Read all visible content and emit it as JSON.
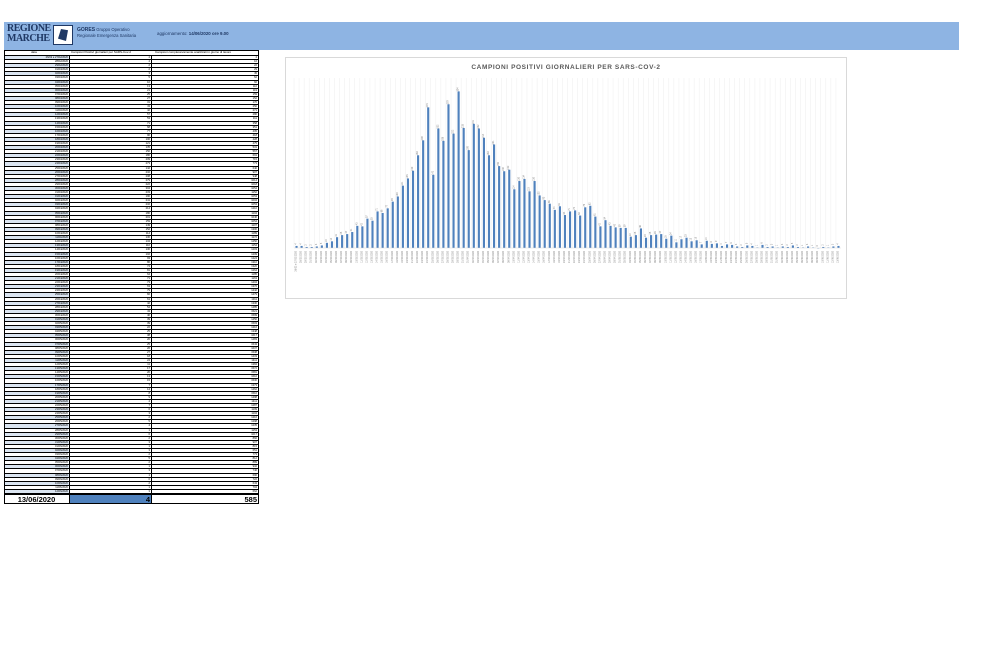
{
  "header": {
    "logo_text": "REGIONE MARCHE",
    "org_name": "GORES",
    "org_desc": "Gruppo Operativo Regionale Emergenza Sanitaria",
    "update_label": "aggiornamento:",
    "update_value": "14/06/2020 ore 9.00",
    "logo_icon": "region-map-icon",
    "band_color": "#8eb4e3"
  },
  "table": {
    "columns": [
      "data",
      "Campioni Positivi giornalieri per SARS-Cov-2",
      "Campioni complessivamente analizzati in giorno di lavoro"
    ],
    "rows": [
      [
        "26/02 e 27/02/2020",
        "4",
        "4"
      ],
      [
        "28/02/2020",
        "4",
        "16"
      ],
      [
        "29/02/2020",
        "2",
        "22"
      ],
      [
        "01/03/2020",
        "2",
        "29"
      ],
      [
        "02/03/2020",
        "3",
        "45"
      ],
      [
        "03/03/2020",
        "5",
        "62"
      ],
      [
        "04/03/2020",
        "10",
        "66"
      ],
      [
        "05/03/2020",
        "13",
        "110"
      ],
      [
        "06/03/2020",
        "21",
        "119"
      ],
      [
        "07/03/2020",
        "25",
        "159"
      ],
      [
        "08/03/2020",
        "27",
        "152"
      ],
      [
        "09/03/2020",
        "31",
        "170"
      ],
      [
        "10/03/2020",
        "43",
        "250"
      ],
      [
        "11/03/2020",
        "42",
        "271"
      ],
      [
        "12/03/2020",
        "57",
        "280"
      ],
      [
        "13/03/2020",
        "53",
        "311"
      ],
      [
        "14/03/2020",
        "71",
        "358"
      ],
      [
        "15/03/2020",
        "68",
        "351"
      ],
      [
        "16/03/2020",
        "77",
        "405"
      ],
      [
        "17/03/2020",
        "90",
        "418"
      ],
      [
        "18/03/2020",
        "100",
        "428"
      ],
      [
        "19/03/2020",
        "121",
        "475"
      ],
      [
        "20/03/2020",
        "135",
        "531"
      ],
      [
        "21/03/2020",
        "150",
        "567"
      ],
      [
        "22/03/2020",
        "180",
        "691"
      ],
      [
        "23/03/2020",
        "209",
        "715"
      ],
      [
        "24/03/2020",
        "273",
        "773"
      ],
      [
        "25/03/2020",
        "142",
        "640"
      ],
      [
        "26/03/2020",
        "232",
        "907"
      ],
      [
        "27/03/2020",
        "208",
        "948"
      ],
      [
        "28/03/2020",
        "279",
        "1014"
      ],
      [
        "29/03/2020",
        "222",
        "1018"
      ],
      [
        "30/03/2020",
        "304",
        "1054"
      ],
      [
        "31/03/2020",
        "233",
        "1152"
      ],
      [
        "01/04/2020",
        "190",
        "1053"
      ],
      [
        "02/04/2020",
        "241",
        "1004"
      ],
      [
        "03/04/2020",
        "232",
        "1053"
      ],
      [
        "04/04/2020",
        "214",
        "1210"
      ],
      [
        "05/04/2020",
        "180",
        "1104"
      ],
      [
        "06/04/2020",
        "201",
        "1046"
      ],
      [
        "07/04/2020",
        "159",
        "1054"
      ],
      [
        "08/04/2020",
        "149",
        "1107"
      ],
      [
        "09/04/2020",
        "152",
        "1300"
      ],
      [
        "10/04/2020",
        "114",
        "1189"
      ],
      [
        "11/04/2020",
        "130",
        "1172"
      ],
      [
        "12/04/2020",
        "134",
        "1250"
      ],
      [
        "13/04/2020",
        "110",
        "1154"
      ],
      [
        "14/04/2020",
        "130",
        "1203"
      ],
      [
        "15/04/2020",
        "102",
        "1209"
      ],
      [
        "16/04/2020",
        "93",
        "1224"
      ],
      [
        "17/04/2020",
        "86",
        "1310"
      ],
      [
        "18/04/2020",
        "74",
        "1320"
      ],
      [
        "19/04/2020",
        "81",
        "1264"
      ],
      [
        "20/04/2020",
        "64",
        "1185"
      ],
      [
        "21/04/2020",
        "71",
        "1163"
      ],
      [
        "22/04/2020",
        "73",
        "1404"
      ],
      [
        "23/04/2020",
        "63",
        "1376"
      ],
      [
        "24/04/2020",
        "79",
        "1442"
      ],
      [
        "25/04/2020",
        "82",
        "1479"
      ],
      [
        "26/04/2020",
        "61",
        "1311"
      ],
      [
        "27/04/2020",
        "42",
        "1330"
      ],
      [
        "28/04/2020",
        "54",
        "1485"
      ],
      [
        "29/04/2020",
        "43",
        "1521"
      ],
      [
        "30/04/2020",
        "40",
        "1599"
      ],
      [
        "01/05/2020",
        "39",
        "1450"
      ],
      [
        "02/05/2020",
        "39",
        "1503"
      ],
      [
        "03/05/2020",
        "22",
        "1216"
      ],
      [
        "04/05/2020",
        "25",
        "1348"
      ],
      [
        "05/05/2020",
        "38",
        "1617"
      ],
      [
        "06/05/2020",
        "20",
        "1483"
      ],
      [
        "07/05/2020",
        "25",
        "1543"
      ],
      [
        "08/05/2020",
        "26",
        "1637"
      ],
      [
        "09/05/2020",
        "27",
        "1538"
      ],
      [
        "10/05/2020",
        "18",
        "1433"
      ],
      [
        "11/05/2020",
        "24",
        "1411"
      ],
      [
        "12/05/2020",
        "11",
        "1384"
      ],
      [
        "13/05/2020",
        "17",
        "1572"
      ],
      [
        "14/05/2020",
        "20",
        "1581"
      ],
      [
        "15/05/2020",
        "13",
        "1610"
      ],
      [
        "16/05/2020",
        "15",
        "1530"
      ],
      [
        "17/05/2020",
        "7",
        "1373"
      ],
      [
        "18/05/2020",
        "14",
        "1462"
      ],
      [
        "19/05/2020",
        "8",
        "1510"
      ],
      [
        "20/05/2020",
        "9",
        "1498"
      ],
      [
        "21/05/2020",
        "4",
        "1411"
      ],
      [
        "22/05/2020",
        "7",
        "1287"
      ],
      [
        "23/05/2020",
        "6",
        "1199"
      ],
      [
        "24/05/2020",
        "3",
        "1104"
      ],
      [
        "25/05/2020",
        "2",
        "1216"
      ],
      [
        "26/05/2020",
        "5",
        "1298"
      ],
      [
        "27/05/2020",
        "4",
        "1235"
      ],
      [
        "28/05/2020",
        "1",
        "1153"
      ],
      [
        "29/05/2020",
        "6",
        "1017"
      ],
      [
        "30/05/2020",
        "2",
        "866"
      ],
      [
        "31/05/2020",
        "3",
        "907"
      ],
      [
        "01/06/2020",
        "1",
        "815"
      ],
      [
        "02/06/2020",
        "3",
        "651"
      ],
      [
        "03/06/2020",
        "2",
        "773"
      ],
      [
        "04/06/2020",
        "5",
        "812"
      ],
      [
        "05/06/2020",
        "2",
        "889"
      ],
      [
        "06/06/2020",
        "1",
        "932"
      ],
      [
        "07/06/2020",
        "3",
        "746"
      ],
      [
        "08/06/2020",
        "1",
        "690"
      ],
      [
        "09/06/2020",
        "0",
        "722"
      ],
      [
        "10/06/2020",
        "2",
        "643"
      ],
      [
        "11/06/2020",
        "1",
        "704"
      ],
      [
        "12/06/2020",
        "3",
        "662"
      ]
    ],
    "final_row": [
      "13/06/2020",
      "4",
      "585"
    ],
    "total_bar_color": "#4f81bd"
  },
  "chart_data": {
    "type": "bar",
    "title": "CAMPIONI POSITIVI GIORNALIERI PER SARS-COV-2",
    "bar_color": "#4f81bd",
    "categories": [
      "26/02 e 27/02/2020",
      "28/02/2020",
      "29/02/2020",
      "01/03/2020",
      "02/03/2020",
      "03/03/2020",
      "04/03/2020",
      "05/03/2020",
      "06/03/2020",
      "07/03/2020",
      "08/03/2020",
      "09/03/2020",
      "10/03/2020",
      "11/03/2020",
      "12/03/2020",
      "13/03/2020",
      "14/03/2020",
      "15/03/2020",
      "16/03/2020",
      "17/03/2020",
      "18/03/2020",
      "19/03/2020",
      "20/03/2020",
      "21/03/2020",
      "22/03/2020",
      "23/03/2020",
      "24/03/2020",
      "25/03/2020",
      "26/03/2020",
      "27/03/2020",
      "28/03/2020",
      "29/03/2020",
      "30/03/2020",
      "31/03/2020",
      "01/04/2020",
      "02/04/2020",
      "03/04/2020",
      "04/04/2020",
      "05/04/2020",
      "06/04/2020",
      "07/04/2020",
      "08/04/2020",
      "09/04/2020",
      "10/04/2020",
      "11/04/2020",
      "12/04/2020",
      "13/04/2020",
      "14/04/2020",
      "15/04/2020",
      "16/04/2020",
      "17/04/2020",
      "18/04/2020",
      "19/04/2020",
      "20/04/2020",
      "21/04/2020",
      "22/04/2020",
      "23/04/2020",
      "24/04/2020",
      "25/04/2020",
      "26/04/2020",
      "27/04/2020",
      "28/04/2020",
      "29/04/2020",
      "30/04/2020",
      "01/05/2020",
      "02/05/2020",
      "03/05/2020",
      "04/05/2020",
      "05/05/2020",
      "06/05/2020",
      "07/05/2020",
      "08/05/2020",
      "09/05/2020",
      "10/05/2020",
      "11/05/2020",
      "12/05/2020",
      "13/05/2020",
      "14/05/2020",
      "15/05/2020",
      "16/05/2020",
      "17/05/2020",
      "18/05/2020",
      "19/05/2020",
      "20/05/2020",
      "21/05/2020",
      "22/05/2020",
      "23/05/2020",
      "24/05/2020",
      "25/05/2020",
      "26/05/2020",
      "27/05/2020",
      "28/05/2020",
      "29/05/2020",
      "30/05/2020",
      "31/05/2020",
      "01/06/2020",
      "02/06/2020",
      "03/06/2020",
      "04/06/2020",
      "05/06/2020",
      "06/06/2020",
      "07/06/2020",
      "08/06/2020",
      "09/06/2020",
      "10/06/2020",
      "11/06/2020",
      "12/06/2020",
      "13/06/2020"
    ],
    "values": [
      4,
      4,
      2,
      2,
      3,
      5,
      10,
      13,
      21,
      25,
      27,
      31,
      43,
      42,
      57,
      53,
      71,
      68,
      77,
      90,
      100,
      121,
      135,
      150,
      180,
      209,
      273,
      142,
      232,
      208,
      279,
      222,
      304,
      233,
      190,
      241,
      232,
      214,
      180,
      201,
      159,
      149,
      152,
      114,
      130,
      134,
      110,
      130,
      102,
      93,
      86,
      74,
      81,
      64,
      71,
      73,
      63,
      79,
      82,
      61,
      42,
      54,
      43,
      40,
      39,
      39,
      22,
      25,
      38,
      20,
      25,
      26,
      27,
      18,
      24,
      11,
      17,
      20,
      13,
      15,
      7,
      14,
      8,
      9,
      4,
      7,
      6,
      3,
      2,
      5,
      4,
      1,
      6,
      2,
      3,
      1,
      3,
      2,
      5,
      2,
      1,
      3,
      1,
      0,
      2,
      1,
      3,
      4
    ],
    "ylim": [
      0,
      330
    ],
    "grid": "vertical",
    "legend": "none"
  }
}
